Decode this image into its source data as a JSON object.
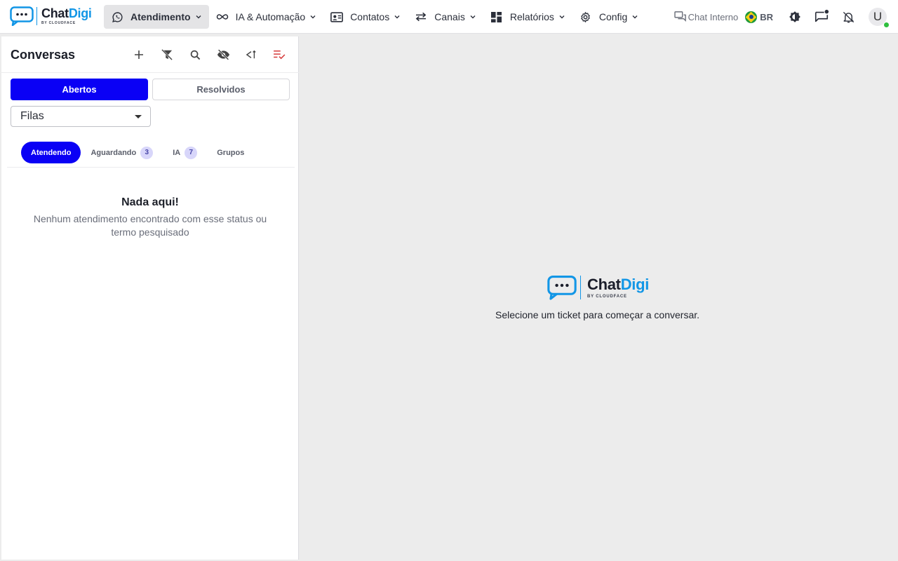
{
  "brand": {
    "word_part1": "Chat",
    "word_part2": "Digi",
    "tagline": "BY CLOUDFACE",
    "colors": {
      "accent": "#1296e6",
      "dark": "#1b1e2b"
    }
  },
  "nav": {
    "items": [
      {
        "label": "Atendimento",
        "icon": "whatsapp-icon",
        "active": true
      },
      {
        "label": "IA & Automação",
        "icon": "infinity-icon",
        "active": false
      },
      {
        "label": "Contatos",
        "icon": "contact-card-icon",
        "active": false
      },
      {
        "label": "Canais",
        "icon": "swap-arrows-icon",
        "active": false
      },
      {
        "label": "Relatórios",
        "icon": "dashboard-icon",
        "active": false
      },
      {
        "label": "Config",
        "icon": "gear-icon",
        "active": false
      }
    ]
  },
  "topbar": {
    "chat_interno": "Chat Interno",
    "language": "BR",
    "user_initial": "U",
    "online_color": "#2fbf3f"
  },
  "sidebar": {
    "title": "Conversas",
    "tools": [
      "plus-icon",
      "filter-off-icon",
      "search-icon",
      "eye-off-icon",
      "collapse-icon",
      "sort-check-icon"
    ],
    "segments": {
      "open": "Abertos",
      "resolved": "Resolvidos"
    },
    "queue_select": "Filas",
    "tabs": [
      {
        "label": "Atendendo",
        "count": ""
      },
      {
        "label": "Aguardando",
        "count": "3"
      },
      {
        "label": "IA",
        "count": "7"
      },
      {
        "label": "Grupos",
        "count": ""
      }
    ],
    "empty": {
      "title": "Nada aqui!",
      "subtitle": "Nenhum atendimento encontrado com esse status ou termo pesquisado"
    },
    "accent": "#0a00f5"
  },
  "main": {
    "message": "Selecione um ticket para começar a conversar."
  }
}
